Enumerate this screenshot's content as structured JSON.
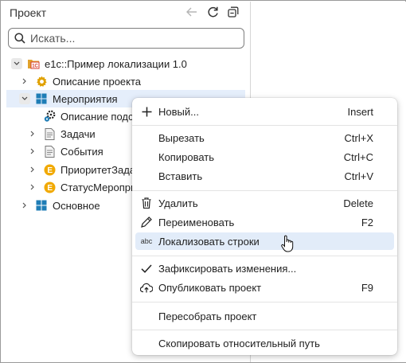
{
  "panel": {
    "title": "Проект"
  },
  "search": {
    "placeholder": "Искать..."
  },
  "tree": {
    "items": [
      {
        "label": "e1c::Пример локализации 1.0",
        "icon": "project-folder-icon"
      },
      {
        "label": "Описание проекта",
        "icon": "gear-icon"
      },
      {
        "label": "Мероприятия",
        "icon": "catalog-icon"
      },
      {
        "label": "Описание подс",
        "icon": "gears-icon"
      },
      {
        "label": "Задачи",
        "icon": "document-icon"
      },
      {
        "label": "События",
        "icon": "document-icon"
      },
      {
        "label": "ПриоритетЗада",
        "icon": "enum-icon"
      },
      {
        "label": "СтатусМероприя",
        "icon": "enum-icon"
      },
      {
        "label": "Основное",
        "icon": "catalog-icon"
      }
    ]
  },
  "menu": {
    "items": [
      {
        "label": "Новый...",
        "shortcut": "Insert",
        "icon": "plus-icon"
      },
      {
        "label": "Вырезать",
        "shortcut": "Ctrl+X"
      },
      {
        "label": "Копировать",
        "shortcut": "Ctrl+C"
      },
      {
        "label": "Вставить",
        "shortcut": "Ctrl+V"
      },
      {
        "label": "Удалить",
        "shortcut": "Delete",
        "icon": "trash-icon"
      },
      {
        "label": "Переименовать",
        "shortcut": "F2",
        "icon": "pencil-icon"
      },
      {
        "label": "Локализовать строки",
        "shortcut": "",
        "icon": "abc-icon",
        "icon_text": "abc"
      },
      {
        "label": "Зафиксировать изменения...",
        "shortcut": "",
        "icon": "checkmark-icon"
      },
      {
        "label": "Опубликовать проект",
        "shortcut": "F9",
        "icon": "cloud-upload-icon"
      },
      {
        "label": "Пересобрать проект",
        "shortcut": ""
      },
      {
        "label": "Скопировать относительный путь",
        "shortcut": ""
      }
    ]
  },
  "colors": {
    "selection": "#e5eefb",
    "hover": "#e2ecf9",
    "gear": "#e0a100",
    "catalog": "#1f7db6",
    "enum": "#f1a900",
    "project": "#d63a2b"
  }
}
